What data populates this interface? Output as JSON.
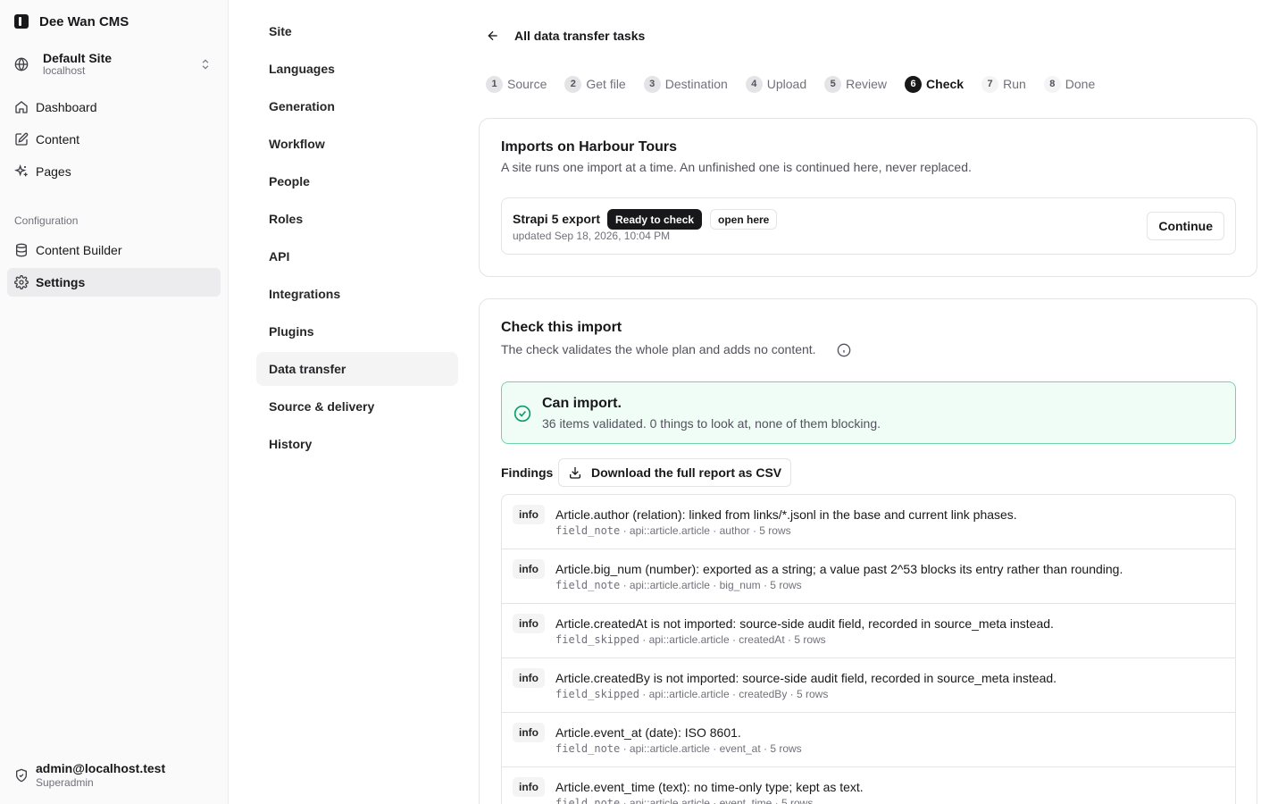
{
  "app": {
    "name": "Dee Wan CMS"
  },
  "site": {
    "name": "Default Site",
    "host": "localhost"
  },
  "sidebar": {
    "items": [
      {
        "label": "Dashboard",
        "icon": "home-icon"
      },
      {
        "label": "Content",
        "icon": "edit-icon"
      },
      {
        "label": "Pages",
        "icon": "sparkle-icon"
      }
    ],
    "section_label": "Configuration",
    "config_items": [
      {
        "label": "Content Builder",
        "icon": "database-icon"
      },
      {
        "label": "Settings",
        "icon": "gear-icon",
        "active": true
      }
    ]
  },
  "user": {
    "email": "admin@localhost.test",
    "role": "Superadmin"
  },
  "settings_nav": {
    "items": [
      "Site",
      "Languages",
      "Generation",
      "Workflow",
      "People",
      "Roles",
      "API",
      "Integrations",
      "Plugins",
      "Data transfer",
      "Source & delivery",
      "History"
    ],
    "active": "Data transfer"
  },
  "header": {
    "back_label": "All data transfer tasks"
  },
  "stepper": {
    "steps": [
      {
        "num": "1",
        "label": "Source",
        "state": "done"
      },
      {
        "num": "2",
        "label": "Get file",
        "state": "done"
      },
      {
        "num": "3",
        "label": "Destination",
        "state": "done"
      },
      {
        "num": "4",
        "label": "Upload",
        "state": "done"
      },
      {
        "num": "5",
        "label": "Review",
        "state": "done"
      },
      {
        "num": "6",
        "label": "Check",
        "state": "current"
      },
      {
        "num": "7",
        "label": "Run",
        "state": "future"
      },
      {
        "num": "8",
        "label": "Done",
        "state": "future"
      }
    ]
  },
  "imports_card": {
    "title": "Imports on Harbour Tours",
    "subtitle": "A site runs one import at a time. An unfinished one is continued here, never replaced.",
    "import": {
      "name": "Strapi 5 export",
      "status": "Ready to check",
      "tag": "open here",
      "updated": "updated Sep 18, 2026, 10:04 PM",
      "action": "Continue"
    }
  },
  "check_card": {
    "title": "Check this import",
    "subtitle": "The check validates the whole plan and adds no content.",
    "result": {
      "title": "Can import.",
      "description": "36 items validated. 0 things to look at, none of them blocking."
    },
    "findings_label": "Findings",
    "download_label": "Download the full report as CSV",
    "findings": [
      {
        "level": "info",
        "message": "Article.author (relation): linked from links/*.jsonl in the base and current link phases.",
        "code": "field_note",
        "detail": " · api::article.article · author · 5 rows"
      },
      {
        "level": "info",
        "message": "Article.big_num (number): exported as a string; a value past 2^53 blocks its entry rather than rounding.",
        "code": "field_note",
        "detail": " · api::article.article · big_num · 5 rows"
      },
      {
        "level": "info",
        "message": "Article.createdAt is not imported: source-side audit field, recorded in source_meta instead.",
        "code": "field_skipped",
        "detail": " · api::article.article · createdAt · 5 rows"
      },
      {
        "level": "info",
        "message": "Article.createdBy is not imported: source-side audit field, recorded in source_meta instead.",
        "code": "field_skipped",
        "detail": " · api::article.article · createdBy · 5 rows"
      },
      {
        "level": "info",
        "message": "Article.event_at (date): ISO 8601.",
        "code": "field_note",
        "detail": " · api::article.article · event_at · 5 rows"
      },
      {
        "level": "info",
        "message": "Article.event_time (text): no time-only type; kept as text.",
        "code": "field_note",
        "detail": " · api::article.article · event_time · 5 rows"
      }
    ]
  }
}
